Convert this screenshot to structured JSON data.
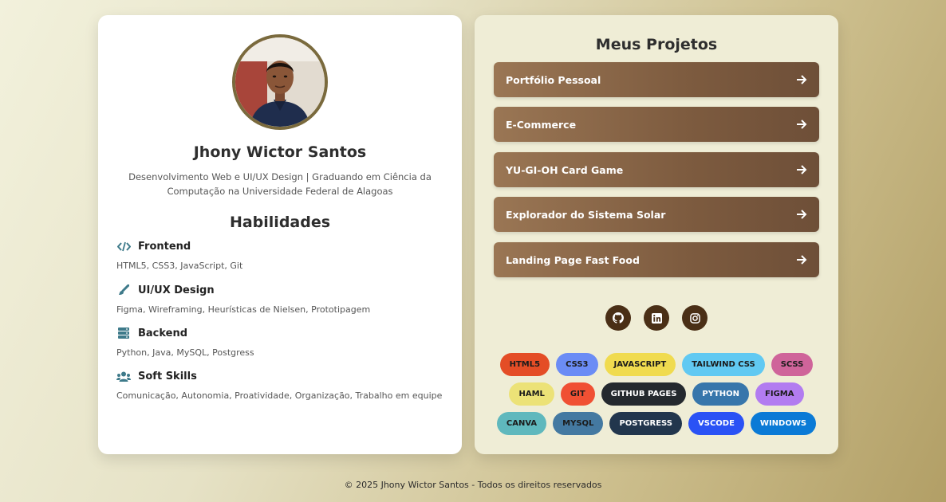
{
  "profile": {
    "name": "Jhony Wictor Santos",
    "bio": "Desenvolvimento Web e UI/UX Design | Graduando em Ciência da Computação na Universidade Federal de Alagoas"
  },
  "skills": {
    "title": "Habilidades",
    "items": [
      {
        "icon": "code-icon",
        "name": "Frontend",
        "desc": "HTML5, CSS3, JavaScript, Git"
      },
      {
        "icon": "brush-icon",
        "name": "UI/UX Design",
        "desc": "Figma, Wireframing, Heurísticas de Nielsen, Prototipagem"
      },
      {
        "icon": "server-icon",
        "name": "Backend",
        "desc": "Python, Java, MySQL, Postgress"
      },
      {
        "icon": "users-icon",
        "name": "Soft Skills",
        "desc": "Comunicação, Autonomia, Proatividade, Organização, Trabalho em equipe"
      }
    ]
  },
  "projects": {
    "title": "Meus Projetos",
    "items": [
      {
        "label": "Portfólio Pessoal"
      },
      {
        "label": "E-Commerce"
      },
      {
        "label": "YU-GI-OH Card Game"
      },
      {
        "label": "Explorador do Sistema Solar"
      },
      {
        "label": "Landing Page Fast Food"
      }
    ]
  },
  "socials": [
    {
      "icon": "github-icon"
    },
    {
      "icon": "linkedin-icon"
    },
    {
      "icon": "instagram-icon"
    }
  ],
  "tags": [
    [
      {
        "label": "HTML5",
        "bg": "#e44d26",
        "fg": "#1b1b1b"
      },
      {
        "label": "CSS3",
        "bg": "#6b8cf5",
        "fg": "#1b1b1b"
      },
      {
        "label": "JAVASCRIPT",
        "bg": "#f0db4f",
        "fg": "#1b1b1b"
      },
      {
        "label": "TAILWIND CSS",
        "bg": "#61c9f2",
        "fg": "#1b1b1b"
      },
      {
        "label": "SCSS",
        "bg": "#cf649a",
        "fg": "#1b1b1b"
      }
    ],
    [
      {
        "label": "HAML",
        "bg": "#ece277",
        "fg": "#1b1b1b"
      },
      {
        "label": "GIT",
        "bg": "#f05033",
        "fg": "#1b1b1b"
      },
      {
        "label": "GITHUB PAGES",
        "bg": "#24292e",
        "fg": "#ffffff"
      },
      {
        "label": "PYTHON",
        "bg": "#3776ab",
        "fg": "#ffffff"
      },
      {
        "label": "FIGMA",
        "bg": "#b27cf0",
        "fg": "#1b1b1b"
      }
    ],
    [
      {
        "label": "CANVA",
        "bg": "#5fb8bd",
        "fg": "#1b1b1b"
      },
      {
        "label": "MYSQL",
        "bg": "#4479a1",
        "fg": "#1b1b1b"
      },
      {
        "label": "POSTGRESS",
        "bg": "#22364d",
        "fg": "#ffffff"
      },
      {
        "label": "VSCODE",
        "bg": "#2a52f5",
        "fg": "#ffffff"
      },
      {
        "label": "WINDOWS",
        "bg": "#0a7ad6",
        "fg": "#ffffff"
      }
    ]
  ],
  "footer": {
    "text": "© 2025 Jhony Wictor Santos - Todos os direitos reservados"
  }
}
